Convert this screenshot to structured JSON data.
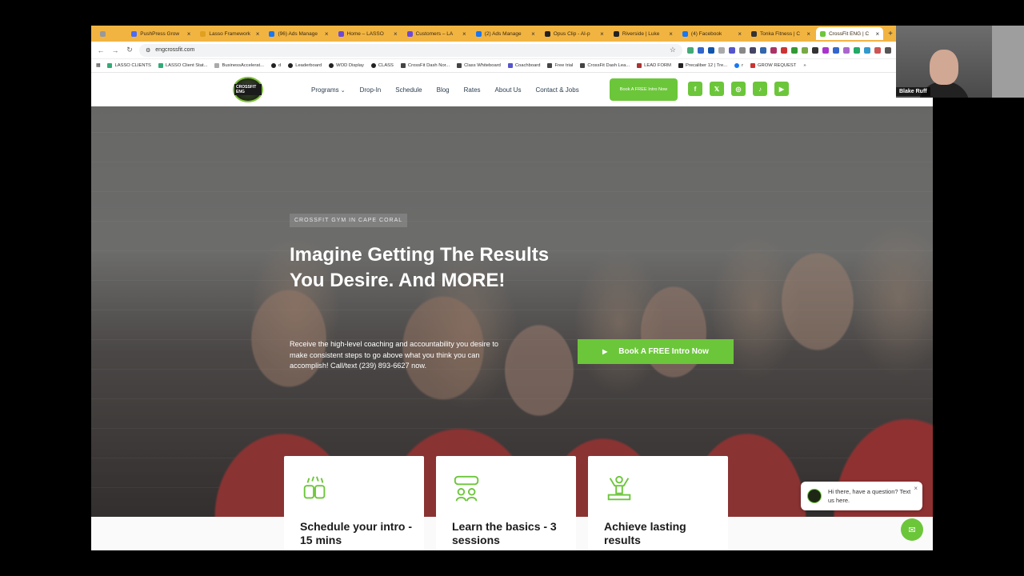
{
  "browser": {
    "tabs": [
      {
        "label": "",
        "color": "#999999"
      },
      {
        "label": "PushPress Grow",
        "color": "#4a6cf7"
      },
      {
        "label": "Lasso Framework",
        "color": "#e0a020"
      },
      {
        "label": "(96) Ads Manage",
        "color": "#1877f2"
      },
      {
        "label": "Home – LASSO",
        "color": "#6c4ad9"
      },
      {
        "label": "Customers – LA",
        "color": "#6c4ad9"
      },
      {
        "label": "(2) Ads Manage",
        "color": "#1877f2"
      },
      {
        "label": "Opus Clip - AI-p",
        "color": "#222222"
      },
      {
        "label": "Riverside | Luke",
        "color": "#222222"
      },
      {
        "label": "(4) Facebook",
        "color": "#1877f2"
      },
      {
        "label": "Tonka Fitness | C",
        "color": "#333333"
      },
      {
        "label": "CrossFit ENG | C",
        "color": "#6cc63a"
      }
    ],
    "url": "engcrossfit.com",
    "bookmarks": [
      "LASSO CLIENTS",
      "LASSO Client Stat...",
      "BusinessAccelerat...",
      "d",
      "Leaderboard",
      "WOD Display",
      "CLASS",
      "CrossFit Dash Nor...",
      "Class Whiteboard",
      "Coachboard",
      "Free trial",
      "CrossFit Dash Lea...",
      "LEAD FORM",
      "Precaliber 12 | Tre...",
      "r",
      "GROW REQUEST"
    ]
  },
  "site": {
    "logo_text": "CROSSFIT ENG",
    "nav": {
      "programs": "Programs",
      "dropin": "Drop-In",
      "schedule": "Schedule",
      "blog": "Blog",
      "rates": "Rates",
      "about": "About Us",
      "contact": "Contact & Jobs",
      "cta": "Book A FREE Intro Now"
    },
    "socials": [
      "f",
      "𝕏",
      "◎",
      "♪",
      "▶"
    ],
    "accent": "#6cc63a"
  },
  "hero": {
    "eyebrow": "CROSSFIT GYM IN CAPE CORAL",
    "headline": "Imagine Getting The Results You Desire. And MORE!",
    "subtext": "Receive the high-level coaching and accountability you desire to make consistent steps to go above what you think you can accomplish! Call/text (239) 893-6627 now.",
    "cta": "Book A FREE Intro Now"
  },
  "cards": [
    {
      "title": "Schedule your intro - 15 mins",
      "icon": "handshake-icon"
    },
    {
      "title": "Learn the basics - 3 sessions",
      "icon": "group-chat-icon"
    },
    {
      "title": "Achieve lasting results",
      "icon": "trophy-person-icon"
    }
  ],
  "chat": {
    "message": "Hi there, have a question? Text us here."
  },
  "webcam": {
    "name": "Blake Ruff"
  }
}
